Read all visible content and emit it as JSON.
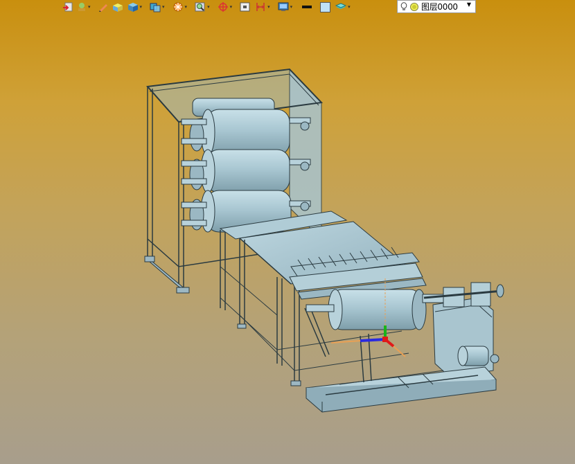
{
  "toolbar": {
    "icons": [
      "import-icon",
      "material-icon",
      "pencil-icon",
      "box-flat-icon",
      "box-shaded-icon",
      "view-cube-icon",
      "render-icon",
      "zoom-fit-icon",
      "snap-icon",
      "frame-icon",
      "dimension-icon",
      "monitor-icon"
    ],
    "line_color": "#111111",
    "fill_color": "#bfe1f5"
  },
  "layer": {
    "label": "图层0000",
    "icons": [
      "lightbulb-icon",
      "visibility-sun-icon"
    ]
  },
  "viewport": {
    "background_top": "#c98f0e",
    "background_bottom": "#a89e8c",
    "model_color": "#a8c8d4",
    "model_edge_color": "#2a3a40"
  }
}
